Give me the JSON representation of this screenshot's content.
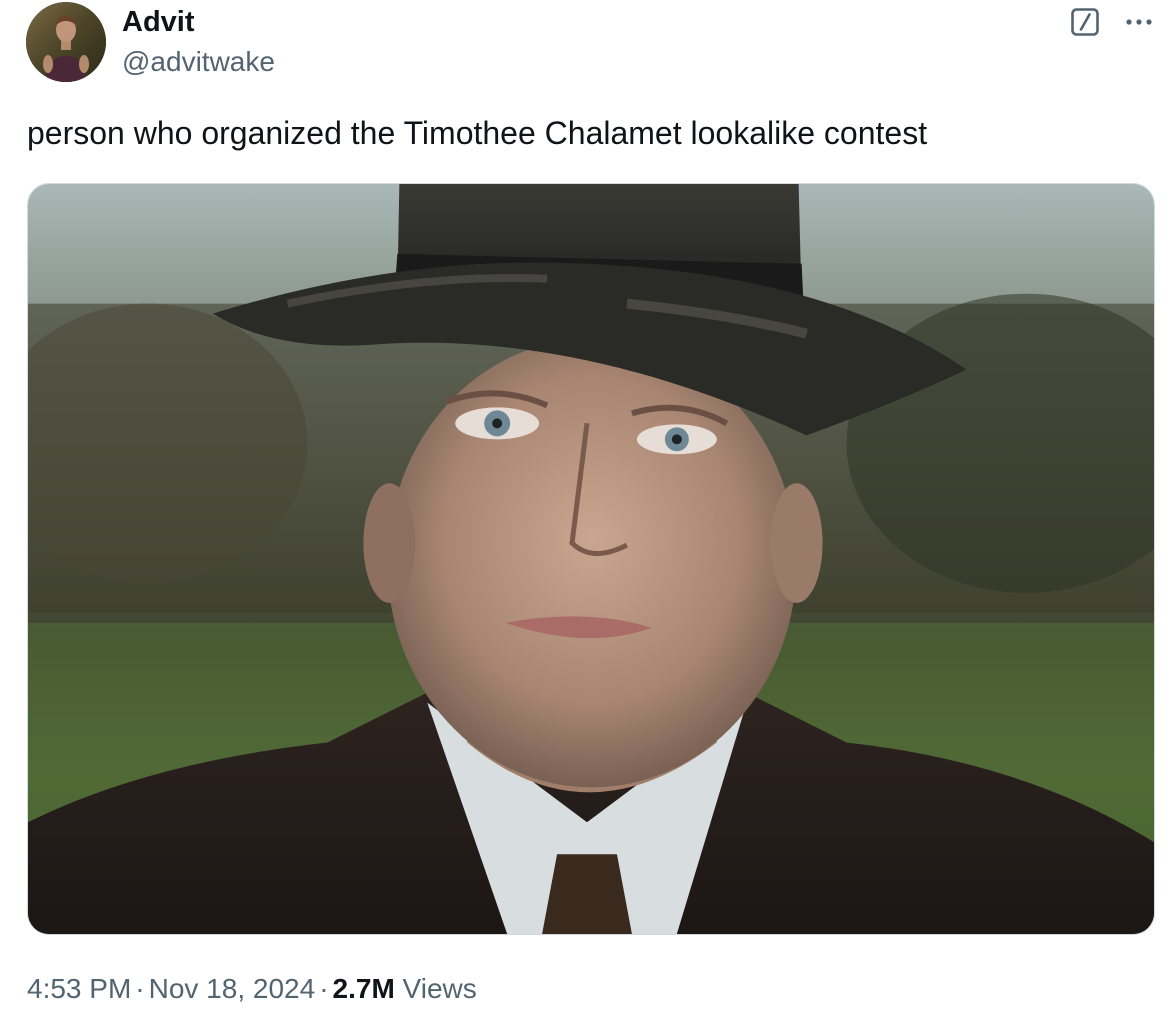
{
  "author": {
    "name": "Advit",
    "handle": "@advitwake",
    "avatar": "user-avatar-photo"
  },
  "header_actions": {
    "grok_icon": "grok-slash-icon",
    "more_icon": "more-dots-icon"
  },
  "tweet": {
    "text": "person who organized the Timothee Chalamet lookalike contest",
    "media": {
      "description_icon": "photo",
      "content": "man-in-fedora-hat-and-suit-photo"
    }
  },
  "meta": {
    "time": "4:53 PM",
    "separator": "·",
    "date": "Nov 18, 2024",
    "views_count": "2.7M",
    "views_label": "Views"
  },
  "colors": {
    "text_primary": "#0f1419",
    "text_secondary": "#536471",
    "border": "#cfd9de"
  }
}
